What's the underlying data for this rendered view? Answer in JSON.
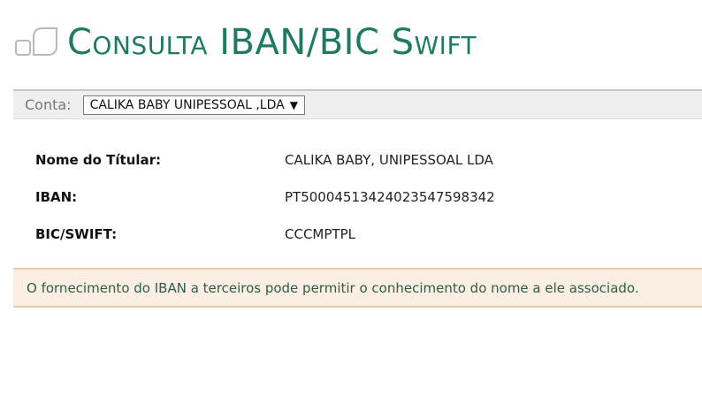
{
  "header": {
    "title": "Consulta IBAN/BIC Swift"
  },
  "account": {
    "label": "Conta:",
    "selected": "CALIKA BABY UNIPESSOAL ,LDA"
  },
  "details": [
    {
      "label": "Nome do Títular:",
      "value": "CALIKA BABY, UNIPESSOAL LDA"
    },
    {
      "label": "IBAN:",
      "value": "PT50004513424023547598342"
    },
    {
      "label": "BIC/SWIFT:",
      "value": "CCCMPTPL"
    }
  ],
  "notice": {
    "text": "O fornecimento do IBAN a terceiros pode permitir o conhecimento do nome a ele associado."
  },
  "colors": {
    "brand_green": "#1f7a63",
    "notice_background": "#fbeee2",
    "notice_border": "#f0c9a8"
  },
  "icons": {
    "logo": "overlapping-squares-logo-icon",
    "dropdown": "caret-down-icon"
  }
}
